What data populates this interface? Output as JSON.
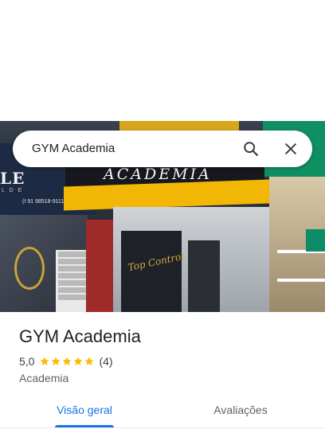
{
  "search": {
    "query": "GYM Academia",
    "search_icon": "search-icon",
    "close_icon": "close-icon"
  },
  "place": {
    "name": "GYM Academia",
    "rating": "5,0",
    "stars": 5,
    "review_count": "(4)",
    "category": "Academia"
  },
  "photo": {
    "sign_text": "ACADEMIA",
    "logo_text": "LE",
    "logo_sub": "L D E",
    "phone": "(I 91 98518-9111",
    "door_script": "Top Control"
  },
  "tabs": [
    {
      "label": "Visão geral",
      "active": true
    },
    {
      "label": "Avaliações",
      "active": false
    }
  ],
  "colors": {
    "accent": "#1a73e8",
    "star": "#fbbc04",
    "text_primary": "#202124",
    "text_secondary": "#5f6368"
  }
}
